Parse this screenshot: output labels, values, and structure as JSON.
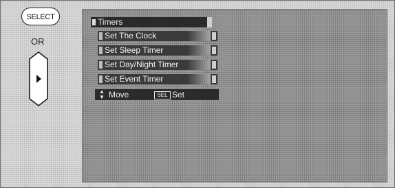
{
  "remote": {
    "select_label": "SELECT",
    "or_label": "OR",
    "arrow_icon": "right-arrow-icon"
  },
  "menu": {
    "title": "Timers",
    "items": [
      {
        "label": "Set The Clock"
      },
      {
        "label": "Set Sleep Timer"
      },
      {
        "label": "Set Day/Night Timer"
      },
      {
        "label": "Set Event Timer"
      }
    ],
    "footer": {
      "move_label": "Move",
      "sel_key": "SEL",
      "set_label": "Set"
    }
  }
}
